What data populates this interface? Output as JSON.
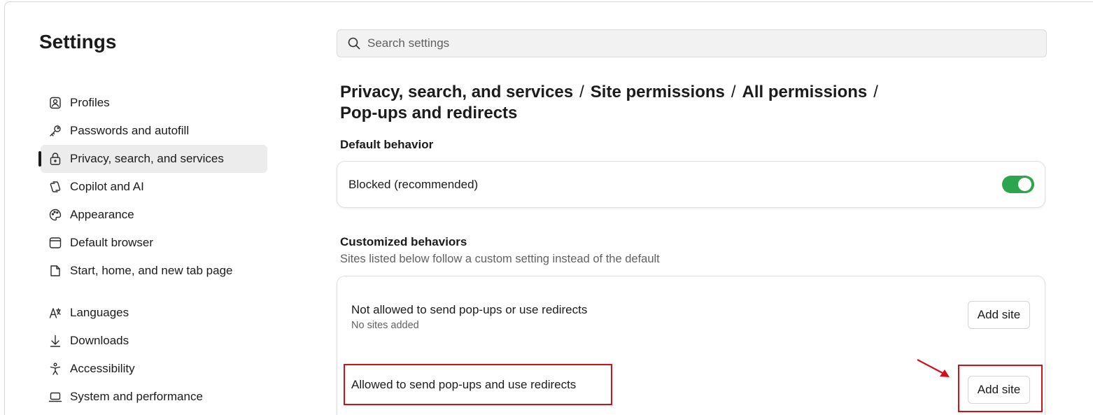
{
  "sidebar": {
    "title": "Settings",
    "items": [
      {
        "label": "Profiles",
        "icon": "profile-icon"
      },
      {
        "label": "Passwords and autofill",
        "icon": "key-icon"
      },
      {
        "label": "Privacy, search, and services",
        "icon": "lock-icon",
        "active": true
      },
      {
        "label": "Copilot and AI",
        "icon": "copilot-icon"
      },
      {
        "label": "Appearance",
        "icon": "palette-icon"
      },
      {
        "label": "Default browser",
        "icon": "browser-icon"
      },
      {
        "label": "Start, home, and new tab page",
        "icon": "home-page-icon"
      },
      {
        "label": "Languages",
        "icon": "languages-icon"
      },
      {
        "label": "Downloads",
        "icon": "download-icon"
      },
      {
        "label": "Accessibility",
        "icon": "accessibility-icon"
      },
      {
        "label": "System and performance",
        "icon": "laptop-icon"
      }
    ]
  },
  "search": {
    "placeholder": "Search settings",
    "value": ""
  },
  "breadcrumb": {
    "parts": [
      "Privacy, search, and services",
      "Site permissions",
      "All permissions",
      "Pop-ups and redirects"
    ],
    "separator": "/"
  },
  "default_behavior": {
    "heading": "Default behavior",
    "label": "Blocked (recommended)",
    "toggle_on": true,
    "toggle_color": "#2da44e"
  },
  "customized": {
    "heading": "Customized behaviors",
    "subtitle": "Sites listed below follow a custom setting instead of the default",
    "not_allowed": {
      "title": "Not allowed to send pop-ups or use redirects",
      "status": "No sites added",
      "button": "Add site"
    },
    "allowed": {
      "title": "Allowed to send pop-ups and use redirects",
      "button": "Add site"
    }
  },
  "annotation": {
    "color": "#d2101c"
  }
}
